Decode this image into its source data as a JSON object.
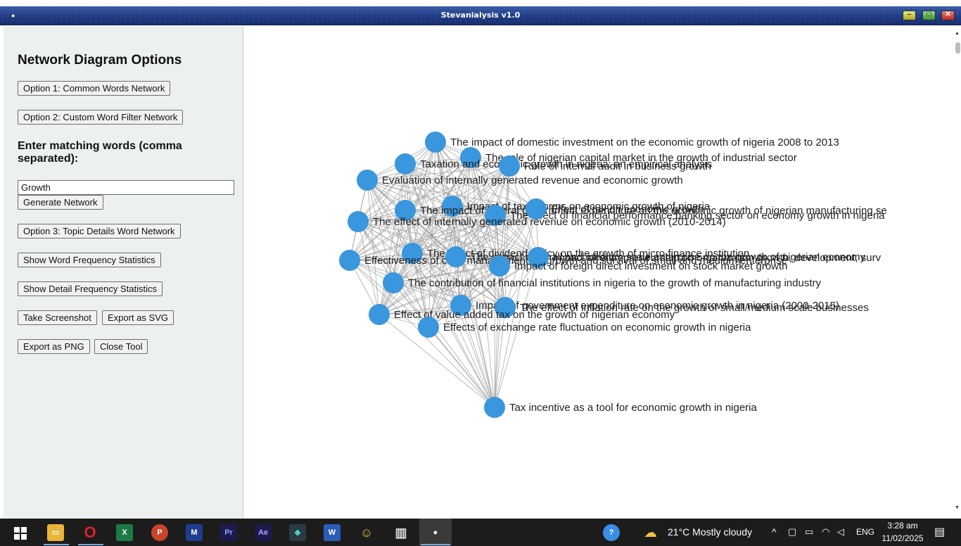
{
  "window": {
    "title": "Stevanialysis v1.0"
  },
  "panel": {
    "title": "Network Diagram Options",
    "buttons": {
      "option1": "Option 1: Common Words Network",
      "option2": "Option 2: Custom Word Filter Network",
      "generate": "Generate Network",
      "option3": "Option 3: Topic Details Word Network",
      "word_freq": "Show Word Frequency Statistics",
      "detail_freq": "Show Detail Frequency Statistics",
      "screenshot": "Take Screenshot",
      "export_svg": "Export as SVG",
      "export_png": "Export as PNG",
      "close": "Close Tool"
    },
    "match_label": "Enter matching words (comma separated):",
    "match_value": "Growth"
  },
  "network": {
    "node_color": "#3a96dd",
    "edge_color": "#9a9a9a",
    "nodes": [
      "The impact of domestic investment on the economic growth of nigeria 2008 to 2013",
      "The role of nigerian capital market in the growth of industrial sector",
      "Taxation and economic growth in nigeria: an empirical analysis",
      "Role of internal audit in business growth",
      "Evaluation of internally generated revenue and economic growth",
      "Impact of tax reforms on economic growth of nigeria",
      "The impact of federal government expenditure on the economic growth of nigerian manufacturing se",
      "The effect of financial performance banking sector on economy growth in nigeria",
      "Effect of tax on economic growth",
      "The effect of internally generated revenue on economic growth (2010-2014)",
      "The effect of dividend policy on the growth of micro finance institution",
      "Effectiveness of cash management on growth and survival of small and medium enterprise",
      "The impact of small and medium scale enterprise on the growth of nigerian economy",
      "Impact of entrepreneurship on organization growth, development, surv",
      "Impact of foreign direct investment on stock market growth",
      "The contribution of financial institutions in nigeria to the growth of manufacturing industry",
      "Impact of government expenditure on economic growth in nigeria (2000-2015)",
      "The effect of inflation rate on the growth of small/medium scale businesses",
      "Effect of value added tax on the growth of nigerian economy",
      "Effects of exchange rate fluctuation on economic growth in nigeria",
      "Tax incentive as a tool for economic growth in nigeria"
    ]
  },
  "taskbar": {
    "weather": "21°C  Mostly cloudy",
    "lang": "ENG",
    "time": "3:28 am",
    "date": "11/02/2025"
  }
}
